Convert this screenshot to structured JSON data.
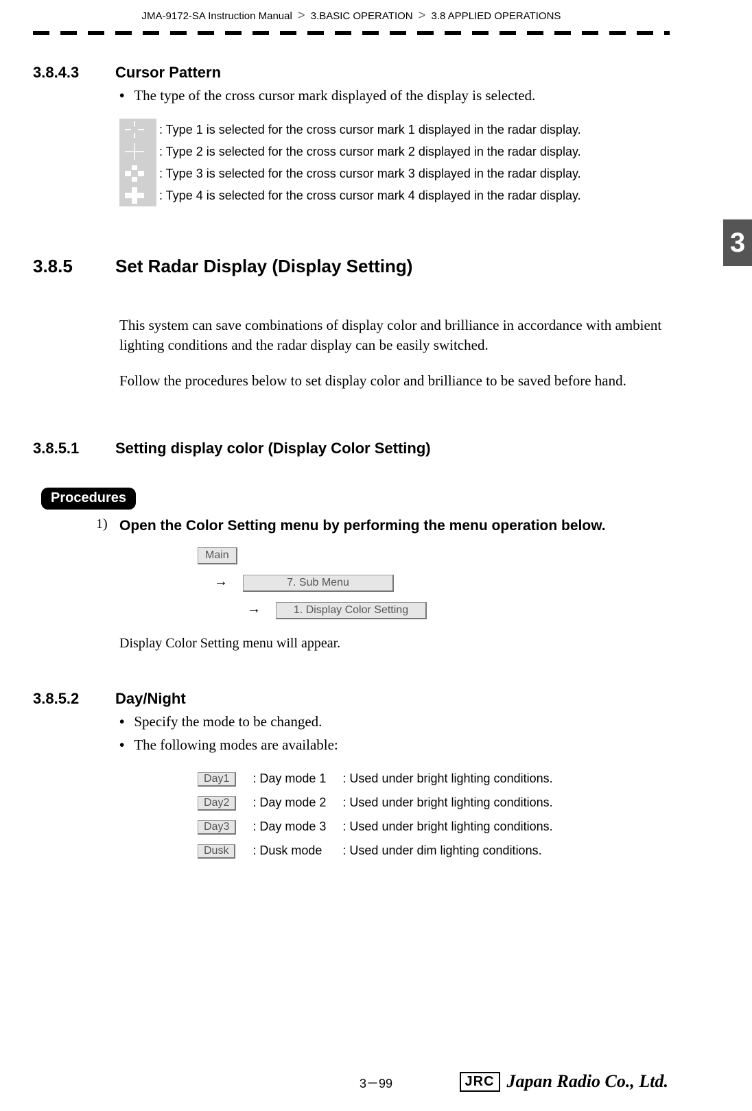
{
  "header": {
    "manual": "JMA-9172-SA Instruction Manual",
    "crumb1": "3.BASIC OPERATION",
    "crumb2": "3.8  APPLIED OPERATIONS"
  },
  "chapter_tab": "3",
  "sections": {
    "s3843": {
      "num": "3.8.4.3",
      "title": "Cursor Pattern"
    },
    "s385": {
      "num": "3.8.5",
      "title": "Set Radar Display (Display Setting)"
    },
    "s3851": {
      "num": "3.8.5.1",
      "title": "Setting display color (Display Color Setting)"
    },
    "s3852": {
      "num": "3.8.5.2",
      "title": "Day/Night"
    }
  },
  "cursor_pattern": {
    "intro": "The type of the cross cursor mark displayed of the display is selected.",
    "rows": [
      ": Type 1 is selected for the cross cursor mark 1 displayed in the radar display.",
      ": Type 2 is selected for the cross cursor mark 2 displayed in the radar display.",
      ": Type 3 is selected for the cross cursor mark 3 displayed in the radar display.",
      ": Type 4 is selected for the cross cursor mark 4 displayed in the radar display."
    ]
  },
  "set_radar": {
    "para1": "This system can save combinations of display color and brilliance in accordance with ambient lighting conditions and the radar display can be easily switched.",
    "para2": "Follow the procedures below to set display color and brilliance to be saved before hand."
  },
  "procedures": {
    "badge": "Procedures",
    "step1_idx": "1)",
    "step1_text": "Open the Color Setting menu by performing the menu operation below.",
    "menu": {
      "main": "Main",
      "sub": "7. Sub Menu",
      "color": "1. Display Color Setting"
    },
    "arrow": "→",
    "after": "Display Color Setting menu will appear."
  },
  "day_night": {
    "bullet1": "Specify the mode to be changed.",
    "bullet2": "The following modes are available:",
    "modes": [
      {
        "btn": "Day1",
        "label": ": Day mode 1",
        "desc": ": Used under bright lighting conditions."
      },
      {
        "btn": "Day2",
        "label": ": Day mode 2",
        "desc": ": Used under bright lighting conditions."
      },
      {
        "btn": "Day3",
        "label": ": Day mode 3",
        "desc": ": Used under bright lighting conditions."
      },
      {
        "btn": "Dusk",
        "label": ": Dusk mode",
        "desc": ": Used under dim lighting conditions."
      }
    ]
  },
  "footer": {
    "page": "3－99",
    "logo_box": "JRC",
    "logo_script": "Japan Radio Co., Ltd."
  }
}
